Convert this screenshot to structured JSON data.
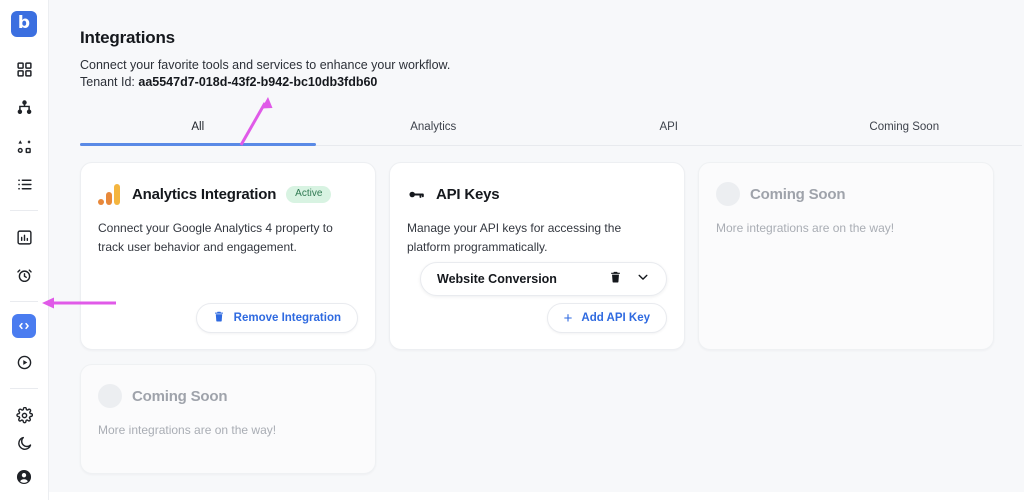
{
  "sidebar": {
    "logo_letter": "b",
    "items": [
      {
        "name": "dashboard",
        "icon": "grid-icon"
      },
      {
        "name": "hierarchy",
        "icon": "sitemap-icon"
      },
      {
        "name": "segments",
        "icon": "segments-icon"
      },
      {
        "name": "list",
        "icon": "list-icon"
      },
      {
        "name": "reports",
        "icon": "bar-chart-icon"
      },
      {
        "name": "alerts",
        "icon": "alarm-clock-icon"
      },
      {
        "name": "integrations",
        "icon": "code-brackets-icon"
      },
      {
        "name": "playback",
        "icon": "play-circle-icon"
      },
      {
        "name": "settings",
        "icon": "gear-icon"
      },
      {
        "name": "theme",
        "icon": "moon-icon"
      },
      {
        "name": "account",
        "icon": "user-circle-icon"
      }
    ]
  },
  "header": {
    "title": "Integrations",
    "subtitle": "Connect your favorite tools and services to enhance your workflow.",
    "tenant_label": "Tenant Id: ",
    "tenant_id": "aa5547d7-018d-43f2-b942-bc10db3fdb60"
  },
  "tabs": [
    {
      "label": "All",
      "active": true
    },
    {
      "label": "Analytics",
      "active": false
    },
    {
      "label": "API",
      "active": false
    },
    {
      "label": "Coming Soon",
      "active": false
    }
  ],
  "cards": {
    "analytics": {
      "title": "Analytics Integration",
      "badge": "Active",
      "description": "Connect your Google Analytics 4 property to track user behavior and engagement.",
      "remove_button": "Remove Integration",
      "icon": "google-analytics-icon",
      "trash_icon": "trash-icon"
    },
    "api_keys": {
      "title": "API Keys",
      "description": "Manage your API keys for accessing the platform programmatically.",
      "icon": "key-icon",
      "key_name": "Website Conversion",
      "key_delete_icon": "trash-icon",
      "key_expand_icon": "chevron-down-icon",
      "add_button": "Add API Key",
      "add_icon": "plus-icon"
    },
    "coming_soon_1": {
      "title": "Coming Soon",
      "description": "More integrations are on the way!"
    },
    "coming_soon_2": {
      "title": "Coming Soon",
      "description": "More integrations are on the way!"
    }
  },
  "colors": {
    "accent_blue": "#2f6ae0",
    "tab_underline": "#5a8ae6",
    "badge_bg": "#d8f3e2",
    "badge_text": "#2f7a52",
    "annotation_pink": "#e05ae8",
    "page_bg": "#f7f8fa",
    "ga_orange": "#e8883a",
    "ga_amber": "#f4b53f"
  },
  "annotations": [
    {
      "name": "arrow-to-all-tab",
      "direction": "up-right"
    },
    {
      "name": "arrow-to-integrations-nav",
      "direction": "left"
    }
  ]
}
